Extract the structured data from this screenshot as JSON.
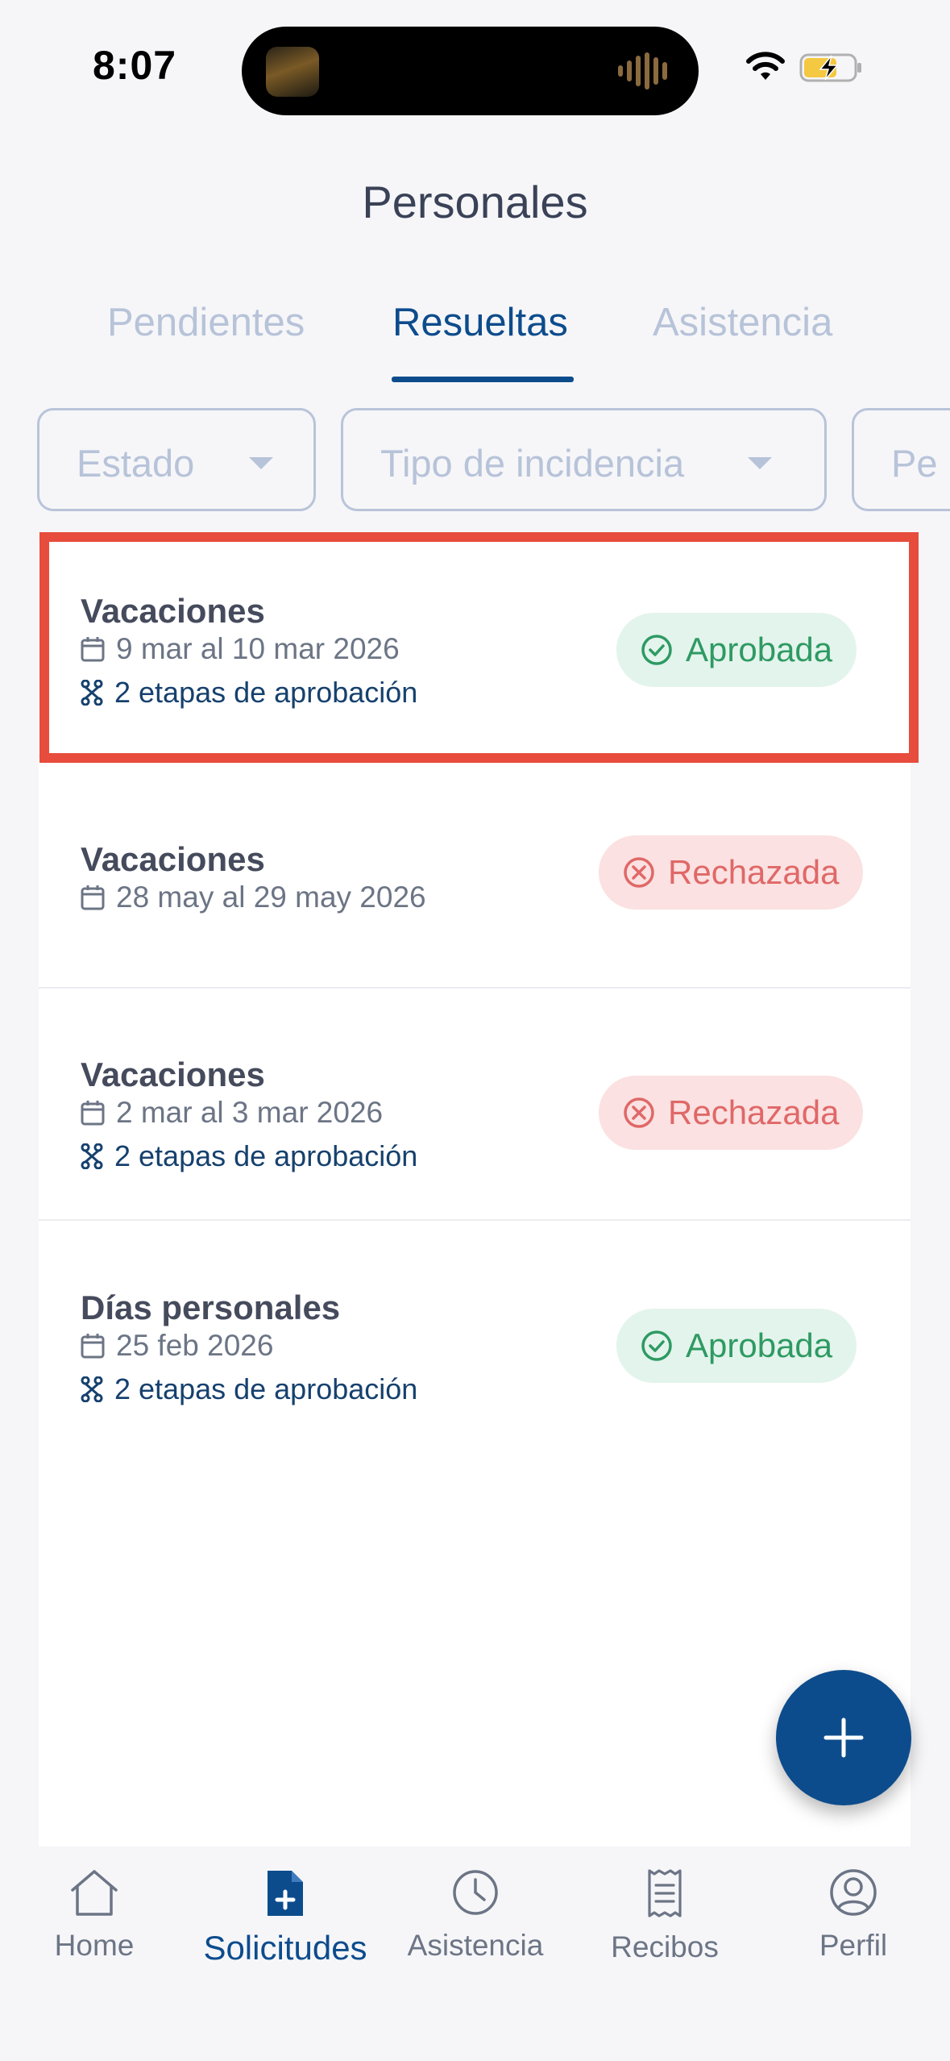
{
  "status_bar": {
    "time": "8:07"
  },
  "header": {
    "title": "Personales"
  },
  "tabs": [
    {
      "label": "Pendientes",
      "active": false
    },
    {
      "label": "Resueltas",
      "active": true
    },
    {
      "label": "Asistencia",
      "active": false
    }
  ],
  "filters": [
    {
      "label": "Estado"
    },
    {
      "label": "Tipo de incidencia"
    },
    {
      "label": "Pe"
    }
  ],
  "requests": [
    {
      "title": "Vacaciones",
      "date": "9 mar al 10 mar 2026",
      "stages": "2 etapas de aprobación",
      "status": "Aprobada",
      "status_type": "approved",
      "highlighted": true
    },
    {
      "title": "Vacaciones",
      "date": "28 may al 29 may 2026",
      "stages": "",
      "status": "Rechazada",
      "status_type": "rejected"
    },
    {
      "title": "Vacaciones",
      "date": "2 mar al 3 mar 2026",
      "stages": "2 etapas de aprobación",
      "status": "Rechazada",
      "status_type": "rejected"
    },
    {
      "title": "Días personales",
      "date": "25 feb 2026",
      "stages": "2 etapas de aprobación",
      "status": "Aprobada",
      "status_type": "approved"
    }
  ],
  "fab": {
    "icon": "plus-icon"
  },
  "bottom_nav": [
    {
      "label": "Home",
      "icon": "home-icon",
      "active": false
    },
    {
      "label": "Solicitudes",
      "icon": "document-add-icon",
      "active": true
    },
    {
      "label": "Asistencia",
      "icon": "clock-icon",
      "active": false
    },
    {
      "label": "Recibos",
      "icon": "receipt-icon",
      "active": false
    },
    {
      "label": "Perfil",
      "icon": "user-circle-icon",
      "active": false
    }
  ],
  "colors": {
    "primary": "#0d4c8c",
    "approved_bg": "#e3f4ec",
    "approved_text": "#2e9a63",
    "rejected_bg": "#fbe1e1",
    "rejected_text": "#e06868",
    "highlight": "#e74c3c"
  }
}
